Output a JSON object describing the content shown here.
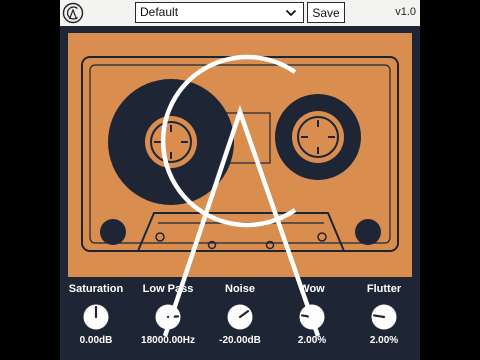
{
  "header": {
    "preset_value": "Default",
    "save_label": "Save",
    "version": "v1.0"
  },
  "colors": {
    "background": "#1e2535",
    "cassette_orange": "#d98e4f",
    "topbar": "#f3f3f2",
    "knob_fill": "#ffffff"
  },
  "knobs": [
    {
      "label": "Saturation",
      "value": "0.00dB",
      "level": 0.5
    },
    {
      "label": "Low Pass",
      "value": "18000.00Hz",
      "level": 0.82
    },
    {
      "label": "Noise",
      "value": "-20.00dB",
      "level": 0.7
    },
    {
      "label": "Wow",
      "value": "2.00%",
      "level": 0.2
    },
    {
      "label": "Flutter",
      "value": "2.00%",
      "level": 0.2
    }
  ],
  "icons": {
    "logo": "ca-logo-icon",
    "dropdown": "chevron-down-icon"
  }
}
